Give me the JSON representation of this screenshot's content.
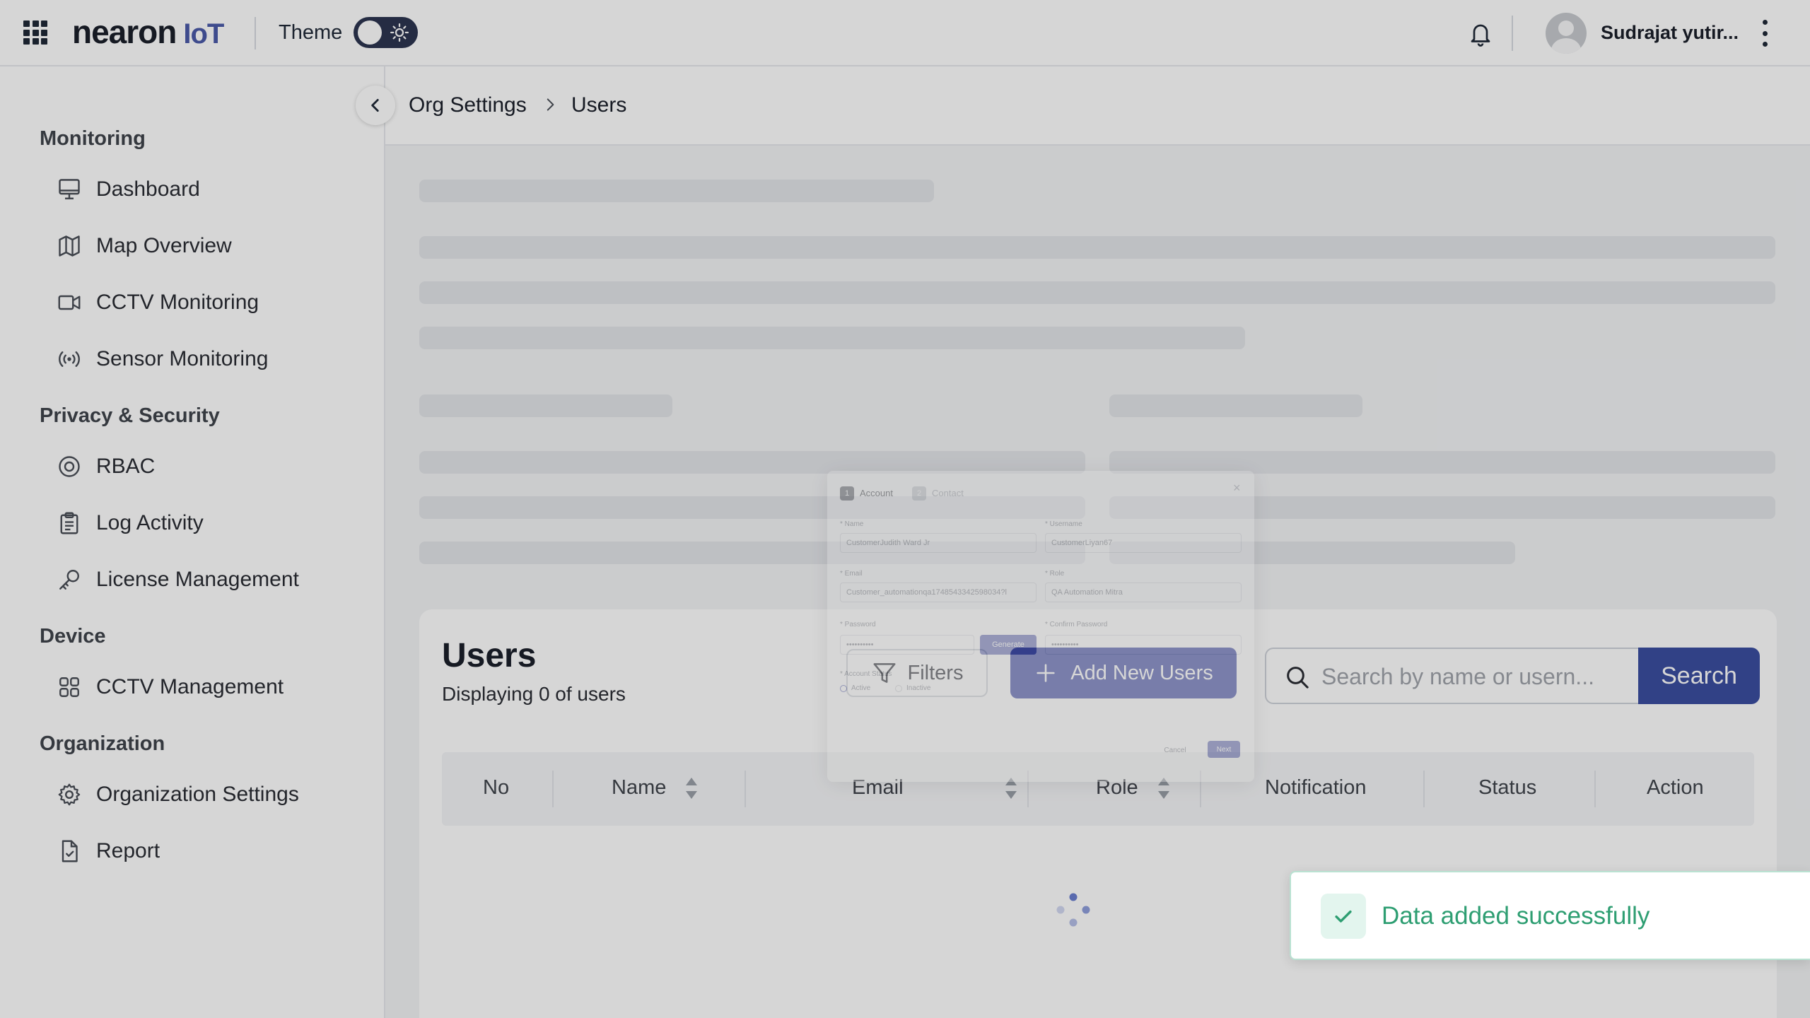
{
  "header": {
    "logo_text": "nearon",
    "logo_suffix": "IoT",
    "theme_label": "Theme",
    "user_name": "Sudrajat yutir..."
  },
  "sidebar": {
    "sections": [
      {
        "title": "Monitoring",
        "items": [
          "Dashboard",
          "Map Overview",
          "CCTV Monitoring",
          "Sensor Monitoring"
        ]
      },
      {
        "title": "Privacy & Security",
        "items": [
          "RBAC",
          "Log Activity",
          "License Management"
        ]
      },
      {
        "title": "Device",
        "items": [
          "CCTV Management"
        ]
      },
      {
        "title": "Organization",
        "items": [
          "Organization Settings",
          "Report"
        ]
      }
    ]
  },
  "breadcrumb": {
    "parent": "Org Settings",
    "current": "Users"
  },
  "users": {
    "title": "Users",
    "subtitle": "Displaying 0 of users",
    "filters_label": "Filters",
    "add_label": "Add New Users",
    "search_placeholder": "Search by name or usern...",
    "search_button": "Search",
    "columns": [
      "No",
      "Name",
      "Email",
      "Role",
      "Notification",
      "Status",
      "Action"
    ]
  },
  "modal": {
    "step1_num": "1",
    "step1_label": "Account",
    "step2_num": "2",
    "step2_label": "Contact",
    "name_label": "* Name",
    "name_value": "CustomerJudith Ward Jr",
    "username_label": "* Username",
    "username_value": "CustomerLiyan67",
    "email_label": "* Email",
    "email_value": "Customer_automationqa1748543342598034?l",
    "role_label": "* Role",
    "role_value": "QA Automation Mitra",
    "password_label": "* Password",
    "password_value": "••••••••••",
    "generate_label": "Generate",
    "confirm_label": "* Confirm Password",
    "confirm_value": "••••••••••",
    "account_status_label": "* Account Status",
    "active_label": "Active",
    "inactive_label": "Inactive",
    "cancel_label": "Cancel",
    "next_label": "Next"
  },
  "toast": {
    "message": "Data added successfully"
  },
  "colors": {
    "primary": "#3f4aa6",
    "success": "#2e9e72",
    "toggle": "#2d3550"
  },
  "icons": {
    "header": [
      "apps-grid-icon",
      "sun-icon",
      "bell-icon",
      "more-vertical-icon"
    ],
    "nav": [
      "monitor-icon",
      "map-icon",
      "video-icon",
      "broadcast-icon",
      "target-icon",
      "clipboard-icon",
      "key-icon",
      "grid-icon",
      "gear-icon",
      "file-check-icon"
    ]
  }
}
